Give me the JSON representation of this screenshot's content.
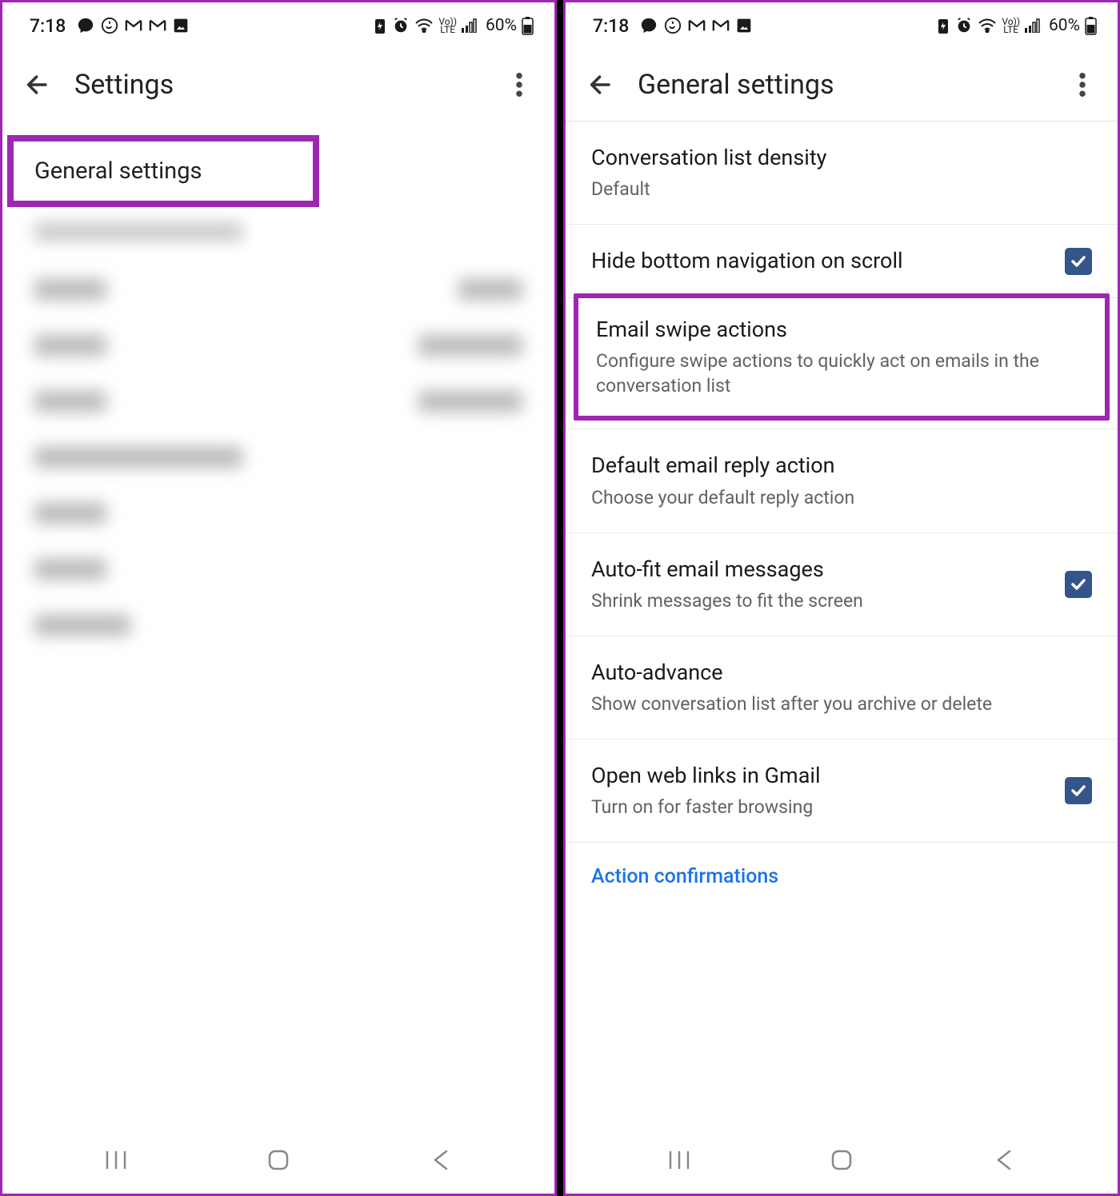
{
  "status": {
    "time": "7:18",
    "battery_text": "60%",
    "lte_top": "Vo))",
    "lte_bot": "LTE"
  },
  "left": {
    "title": "Settings",
    "general_settings_label": "General settings"
  },
  "right": {
    "title": "General settings",
    "items": [
      {
        "title": "Conversation list density",
        "sub": "Default",
        "checkbox": false
      },
      {
        "title": "Hide bottom navigation on scroll",
        "sub": "",
        "checkbox": true
      },
      {
        "title": "Email swipe actions",
        "sub": "Configure swipe actions to quickly act on emails in the conversation list",
        "checkbox": false
      },
      {
        "title": "Default email reply action",
        "sub": "Choose your default reply action",
        "checkbox": false
      },
      {
        "title": "Auto-fit email messages",
        "sub": "Shrink messages to fit the screen",
        "checkbox": true
      },
      {
        "title": "Auto-advance",
        "sub": "Show conversation list after you archive or delete",
        "checkbox": false
      },
      {
        "title": "Open web links in Gmail",
        "sub": "Turn on for faster browsing",
        "checkbox": true
      }
    ],
    "section_header": "Action confirmations"
  },
  "colors": {
    "highlight": "#9c27b0",
    "checkbox_bg": "#34558a",
    "link_blue": "#1a73e8"
  }
}
